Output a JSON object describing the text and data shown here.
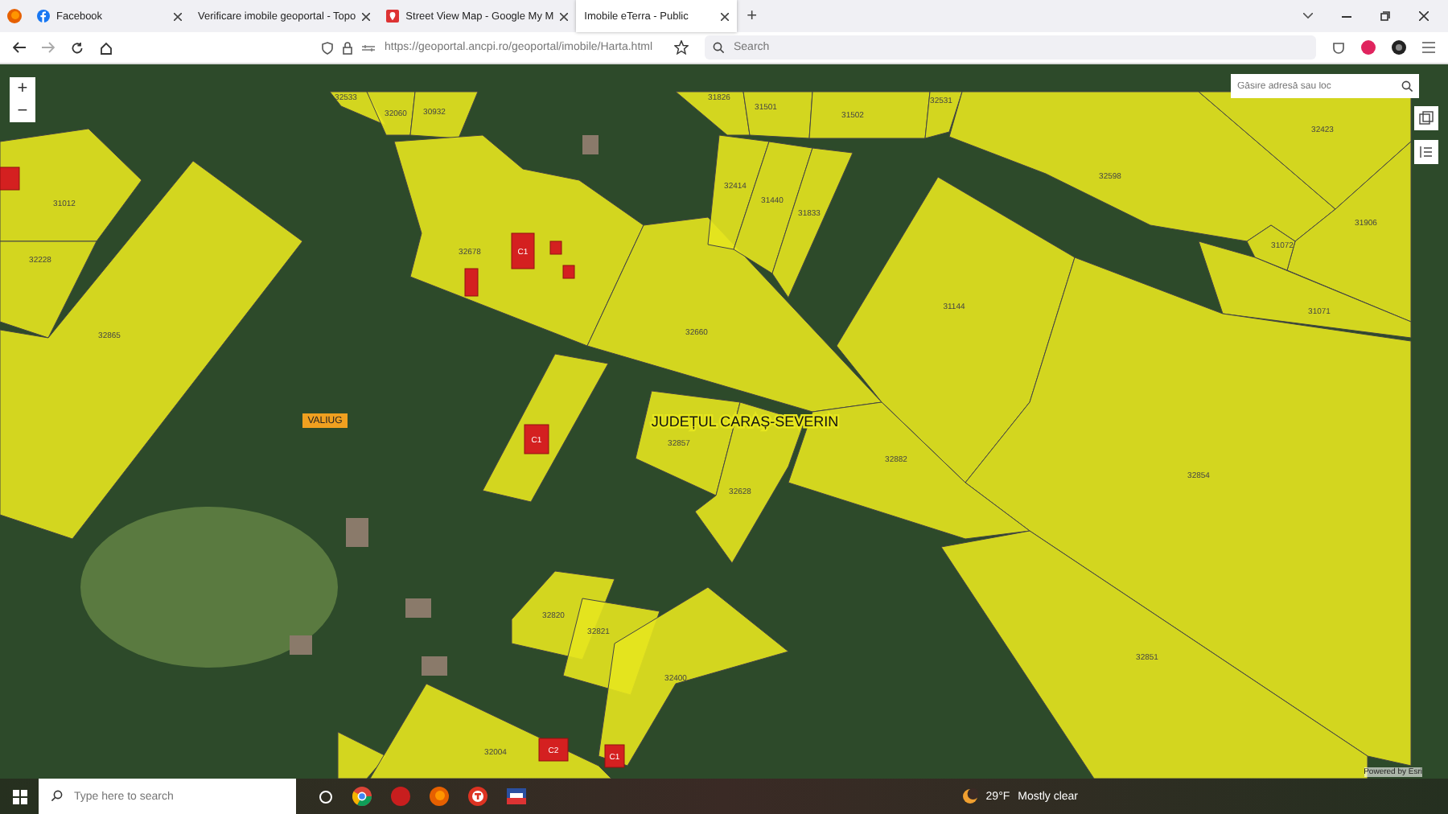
{
  "browser": {
    "tabs": [
      {
        "title": "Facebook",
        "selected": false
      },
      {
        "title": "Verificare imobile geoportal - Topo",
        "selected": false
      },
      {
        "title": "Street View Map - Google My M",
        "selected": false
      },
      {
        "title": "Imobile eTerra - Public",
        "selected": true
      }
    ],
    "new_tab": "+",
    "address": "https://geoportal.ancpi.ro/geoportal/imobile/Harta.html",
    "search": {
      "placeholder": "Search"
    }
  },
  "map": {
    "zoom_controls": [
      "+",
      "−"
    ],
    "search": {
      "placeholder": "Găsire adresă sau loc"
    },
    "parcels": [
      {
        "label": "31012"
      },
      {
        "label": "32228"
      },
      {
        "label": "32865"
      },
      {
        "label": "32533"
      },
      {
        "label": "32060"
      },
      {
        "label": "30932"
      },
      {
        "label": "32678"
      },
      {
        "label": "32660"
      },
      {
        "label": "32414"
      },
      {
        "label": "31440"
      },
      {
        "label": "31833"
      },
      {
        "label": "31826"
      },
      {
        "label": "31501"
      },
      {
        "label": "31502"
      },
      {
        "label": "32531"
      },
      {
        "label": "32598"
      },
      {
        "label": "32423"
      },
      {
        "label": "31906"
      },
      {
        "label": "31072"
      },
      {
        "label": "31071"
      },
      {
        "label": "31144"
      },
      {
        "label": "32854"
      },
      {
        "label": "32882"
      },
      {
        "label": "32851"
      },
      {
        "label": "32857"
      },
      {
        "label": "32628"
      },
      {
        "label": "32820"
      },
      {
        "label": "32821"
      },
      {
        "label": "32400"
      },
      {
        "label": "32004"
      }
    ],
    "buildings": [
      {
        "label": "C1"
      },
      {
        "label": "C1"
      },
      {
        "label": "C2"
      },
      {
        "label": "C1"
      }
    ],
    "place_labels": [
      {
        "kind": "locality",
        "text": "VALIUG"
      },
      {
        "kind": "county",
        "text": "JUDEȚUL CARAȘ-SEVERIN"
      }
    ],
    "attribution": "Powered by Esri"
  },
  "taskbar": {
    "search": {
      "placeholder": "Type here to search"
    },
    "weather": {
      "temperature": "29°F",
      "condition": "Mostly clear"
    }
  }
}
